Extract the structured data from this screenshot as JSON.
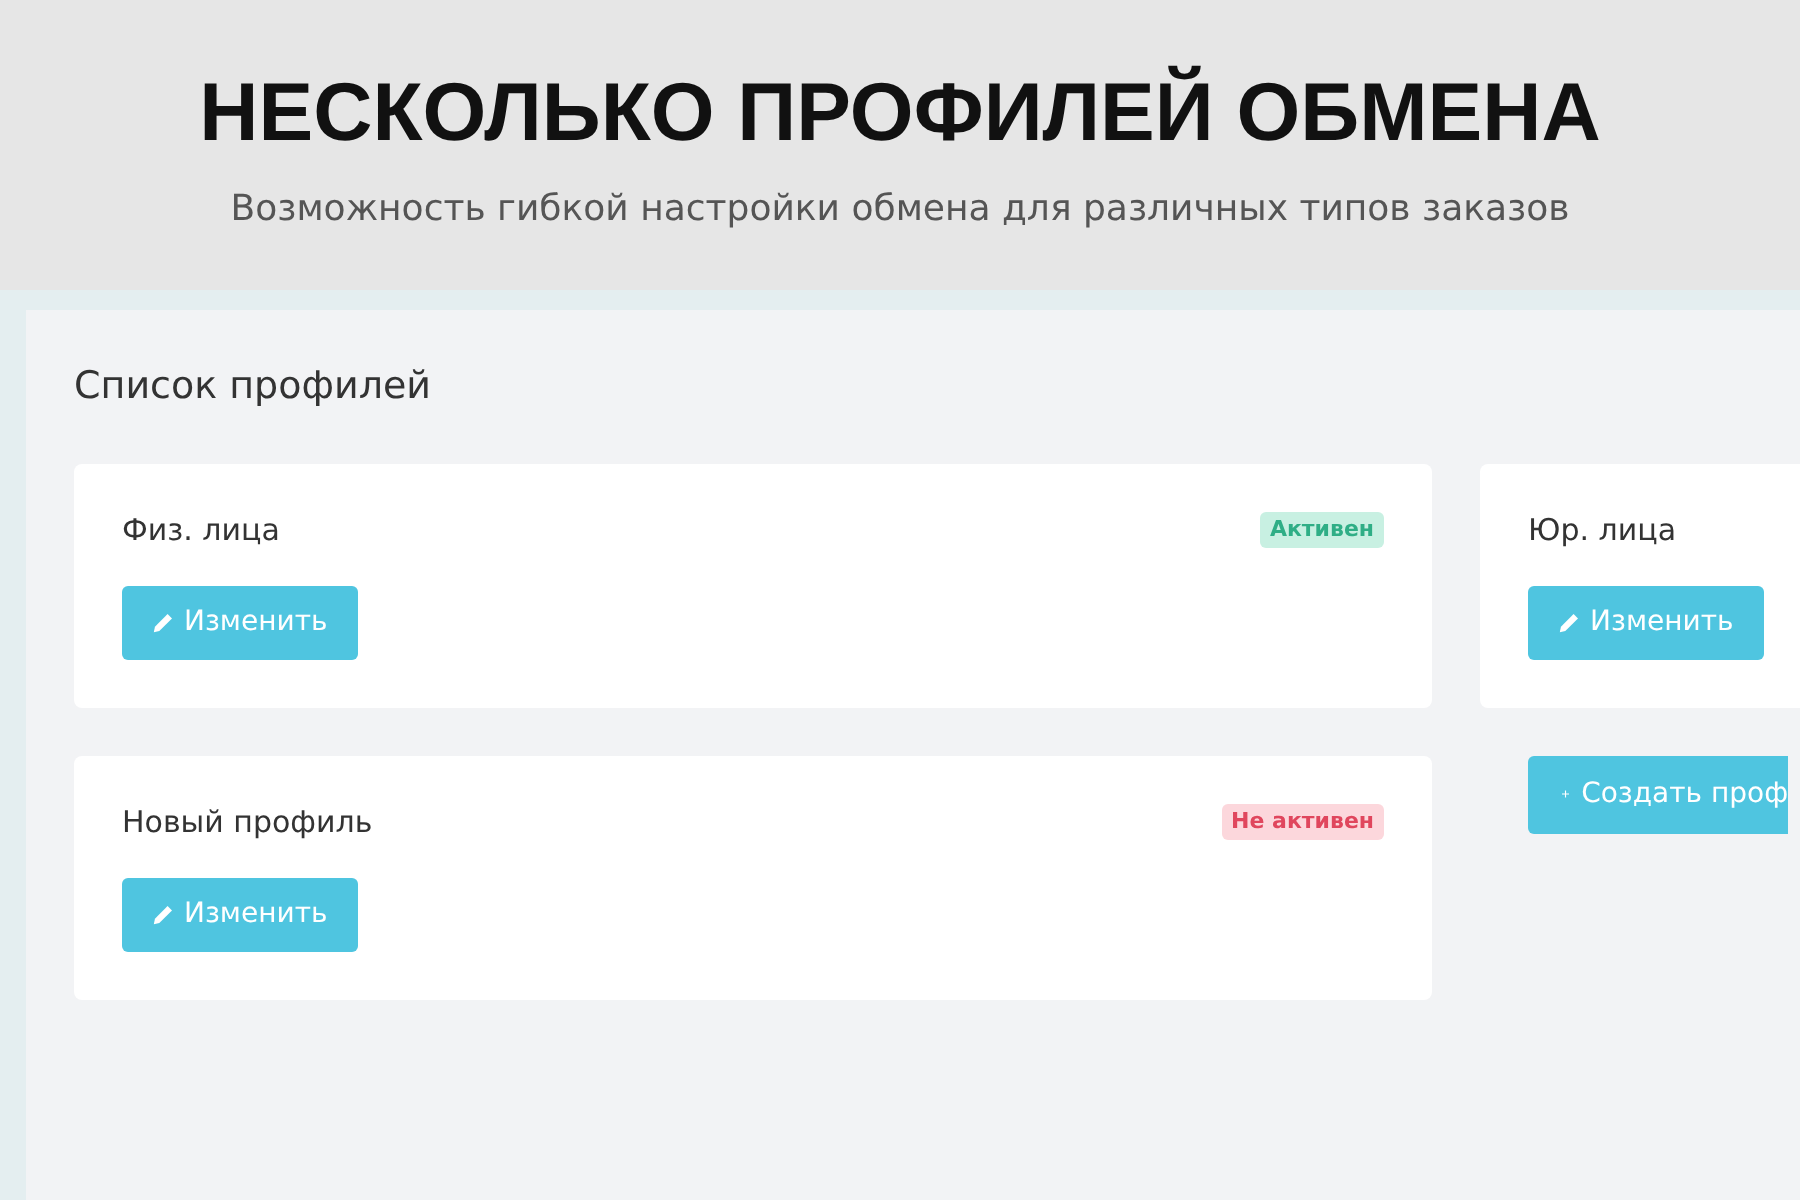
{
  "header": {
    "title": "НЕСКОЛЬКО ПРОФИЛЕЙ ОБМЕНА",
    "subtitle": "Возможность гибкой настройки обмена для различных типов заказов"
  },
  "panel": {
    "title": "Список профилей",
    "columns": [
      {
        "profiles": [
          {
            "name": "Физ. лица",
            "status": {
              "label": "Активен",
              "active": true
            },
            "edit_label": "Изменить"
          },
          {
            "name": "Новый профиль",
            "status": {
              "label": "Не активен",
              "active": false
            },
            "edit_label": "Изменить"
          }
        ]
      },
      {
        "profiles": [
          {
            "name": "Юр. лица",
            "edit_label": "Изменить"
          }
        ],
        "create_label": "Создать проф"
      }
    ]
  }
}
